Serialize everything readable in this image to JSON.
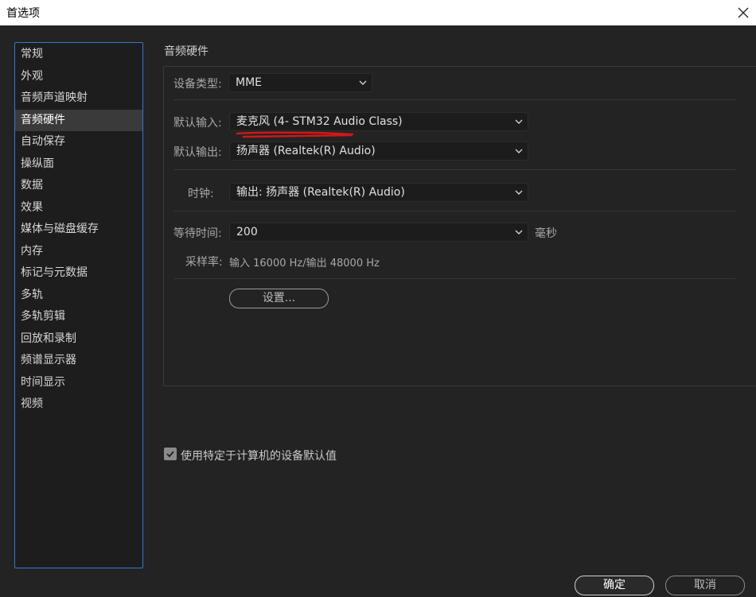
{
  "window": {
    "title": "首选项"
  },
  "sidebar": {
    "items": [
      {
        "label": "常规",
        "selected": false
      },
      {
        "label": "外观",
        "selected": false
      },
      {
        "label": "音频声道映射",
        "selected": false
      },
      {
        "label": "音频硬件",
        "selected": true
      },
      {
        "label": "自动保存",
        "selected": false
      },
      {
        "label": "操纵面",
        "selected": false
      },
      {
        "label": "数据",
        "selected": false
      },
      {
        "label": "效果",
        "selected": false
      },
      {
        "label": "媒体与磁盘缓存",
        "selected": false
      },
      {
        "label": "内存",
        "selected": false
      },
      {
        "label": "标记与元数据",
        "selected": false
      },
      {
        "label": "多轨",
        "selected": false
      },
      {
        "label": "多轨剪辑",
        "selected": false
      },
      {
        "label": "回放和录制",
        "selected": false
      },
      {
        "label": "频谱显示器",
        "selected": false
      },
      {
        "label": "时间显示",
        "selected": false
      },
      {
        "label": "视频",
        "selected": false
      }
    ]
  },
  "main": {
    "section_title": "音频硬件",
    "device_type": {
      "label": "设备类型:",
      "value": "MME"
    },
    "default_input": {
      "label": "默认输入:",
      "value": "麦克风 (4- STM32 Audio Class)"
    },
    "default_output": {
      "label": "默认输出:",
      "value": "扬声器 (Realtek(R) Audio)"
    },
    "clock": {
      "label": "时钟:",
      "value": "输出: 扬声器 (Realtek(R) Audio)"
    },
    "latency": {
      "label": "等待时间:",
      "value": "200",
      "unit": "毫秒"
    },
    "sample_rate": {
      "label": "采样率:",
      "value": "输入 16000 Hz/输出 48000 Hz"
    },
    "settings_button": "设置..."
  },
  "checkbox": {
    "label": "使用特定于计算机的设备默认值",
    "checked": true
  },
  "footer": {
    "ok": "确定",
    "cancel": "取消"
  },
  "colors": {
    "background": "#232323",
    "accent_border": "#2f7bd3",
    "annotation": "#d01818"
  }
}
